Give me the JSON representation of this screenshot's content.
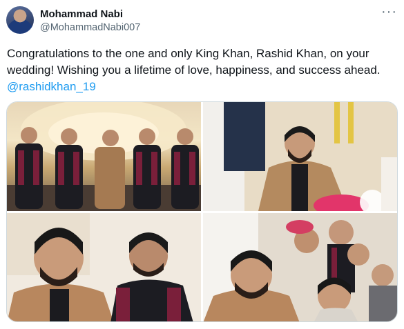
{
  "tweet": {
    "author_name": "Mohammad Nabi",
    "author_handle": "@MohammadNabi007",
    "more_label": "···",
    "text": "Congratulations to the one and only King Khan, Rashid Khan, on your wedding! Wishing you a lifetime of love, happiness, and success ahead.",
    "mention": "@rashidkhan_19"
  },
  "media": {
    "photo_count": 4
  },
  "icons": {
    "more": "more-horizontal-icon"
  },
  "colors": {
    "link": "#1d9bf0",
    "secondary_text": "#536471",
    "primary_text": "#0f1419"
  }
}
